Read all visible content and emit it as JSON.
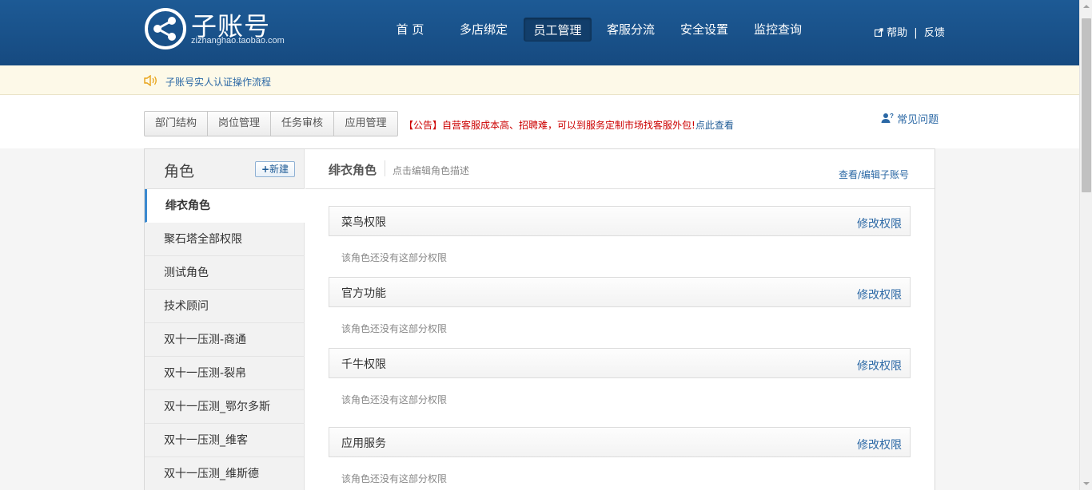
{
  "logo": {
    "title": "子账号",
    "subtitle": "zizhanghao.taobao.com",
    "icon": "share-network-icon"
  },
  "nav": [
    "首 页",
    "多店绑定",
    "员工管理",
    "客服分流",
    "安全设置",
    "监控查询"
  ],
  "nav_active": "员工管理",
  "help": {
    "help": "帮助",
    "sep": "|",
    "feedback": "反馈",
    "icon": "external-link-icon"
  },
  "notice": {
    "text": "子账号实人认证操作流程",
    "icon": "speaker-icon"
  },
  "subtabs": [
    "部门结构",
    "岗位管理",
    "任务审核",
    "应用管理"
  ],
  "announcement": {
    "text": "【公告】自营客服成本高、招聘难，可以到服务定制市场找客服外包!",
    "link": "点此查看"
  },
  "faq": {
    "label": "常见问题",
    "icon": "user-question-icon"
  },
  "sidebar": {
    "title": "角色",
    "new_button": {
      "plus": "+",
      "label": "新建"
    },
    "roles": [
      "绯衣角色",
      "聚石塔全部权限",
      "测试角色",
      "技术顾问",
      "双十一压测-商通",
      "双十一压测-裂帛",
      "双十一压测_鄂尔多斯",
      "双十一压测_维客",
      "双十一压测_维斯德"
    ],
    "active_role": "绯衣角色"
  },
  "content": {
    "role_name": "绯衣角色",
    "role_desc": "点击编辑角色描述",
    "edit_link": "查看/编辑子账号",
    "permissions": [
      {
        "title": "菜鸟权限",
        "edit": "修改权限",
        "empty": "该角色还没有这部分权限"
      },
      {
        "title": "官方功能",
        "edit": "修改权限",
        "empty": "该角色还没有这部分权限"
      },
      {
        "title": "千牛权限",
        "edit": "修改权限",
        "empty": "该角色还没有这部分权限"
      },
      {
        "title": "应用服务",
        "edit": "修改权限",
        "empty": "该角色还没有这部分权限"
      }
    ]
  },
  "colors": {
    "header": "#1d5a95",
    "link": "#2b68a5",
    "announce": "#cc0000",
    "notice_bg": "#fdf9e8"
  }
}
